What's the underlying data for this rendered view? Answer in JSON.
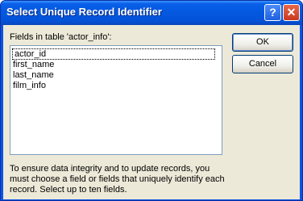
{
  "window": {
    "title": "Select Unique Record Identifier",
    "help_glyph": "?",
    "close_glyph": "✕"
  },
  "fields": {
    "label": "Fields in table 'actor_info':",
    "items": [
      "actor_id",
      "first_name",
      "last_name",
      "film_info"
    ],
    "selected_index": 0
  },
  "buttons": {
    "ok": "OK",
    "cancel": "Cancel"
  },
  "help_text": [
    "To ensure data integrity and to update records, you",
    "must choose a field or fields that uniquely identify each",
    "record. Select up to ten fields."
  ],
  "colors": {
    "titlebar": "#0458e0",
    "dialog_bg": "#ece9d8",
    "close_button": "#c8381e"
  }
}
